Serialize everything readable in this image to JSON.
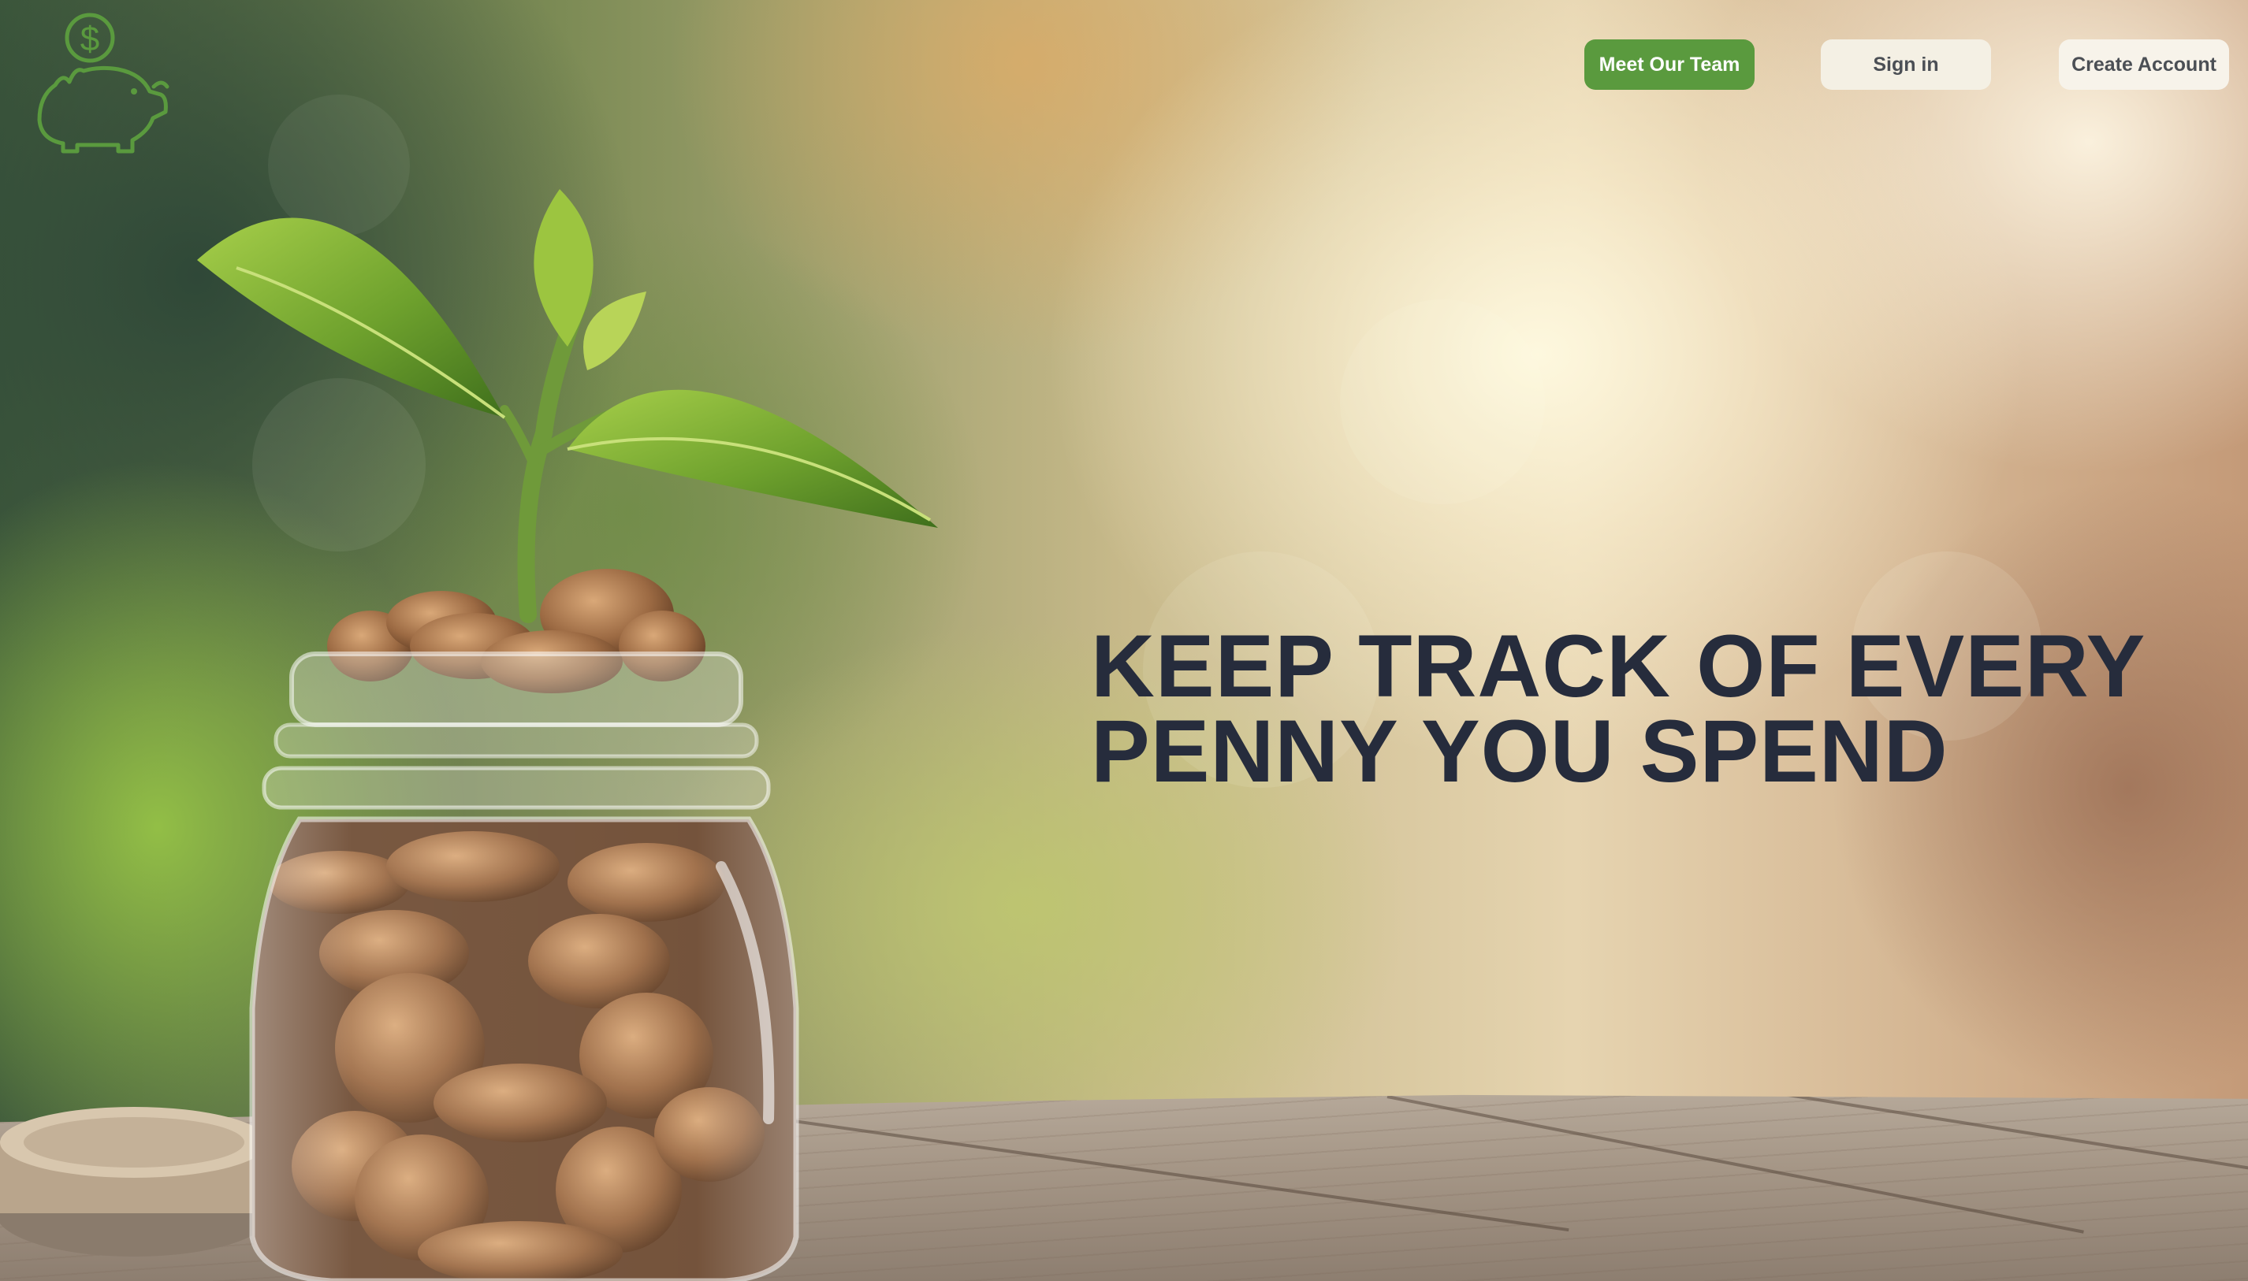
{
  "logo": {
    "icon": "piggy-bank-dollar-icon",
    "color": "#5a9a3e"
  },
  "nav": {
    "team_label": "Meet Our Team",
    "signin_label": "Sign in",
    "create_label": "Create Account"
  },
  "hero": {
    "headline_line1": "KEEP TRACK OF EVERY",
    "headline_line2": "PENNY YOU SPEND",
    "image": "coin-jar-plant-illustration"
  },
  "colors": {
    "accent_green": "#5a9a3e",
    "headline": "#262c3c",
    "button_light": "#f4f0e4"
  }
}
